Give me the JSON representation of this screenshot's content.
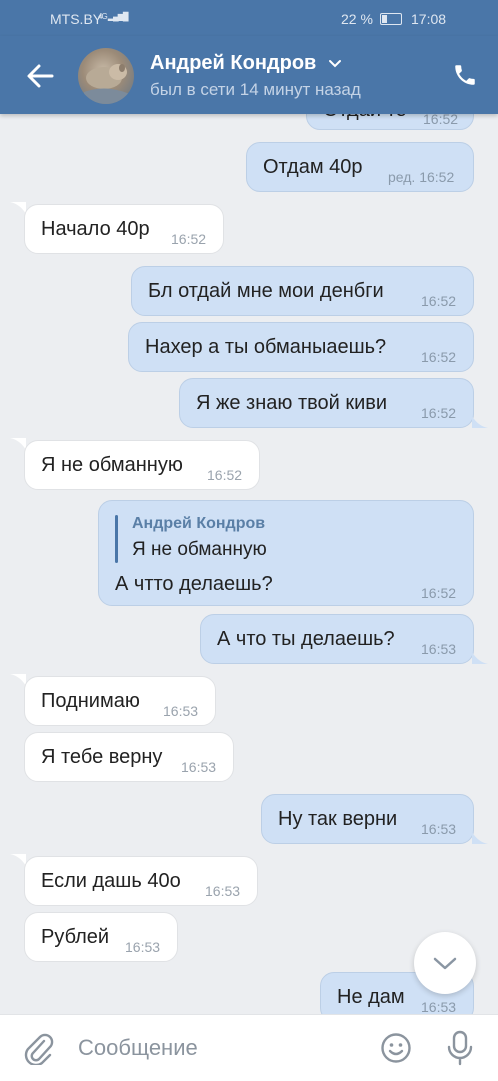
{
  "status_bar": {
    "carrier": "MTS.BY",
    "signal_label": "4G",
    "battery": "22 %",
    "time": "17:08"
  },
  "header": {
    "name": "Андрей Кондров",
    "status": "был в сети 14 минут назад"
  },
  "messages": [
    {
      "dir": "out",
      "text": "Отдай те",
      "time": "16:52"
    },
    {
      "dir": "out",
      "text": "Отдам  40р",
      "time": "ред. 16:52"
    },
    {
      "dir": "in",
      "text": "Начало 40р",
      "time": "16:52"
    },
    {
      "dir": "out",
      "text": "Бл отдай мне мои денбги",
      "time": "16:52"
    },
    {
      "dir": "out",
      "text": "Нахер а ты обманыаешь?",
      "time": "16:52"
    },
    {
      "dir": "out",
      "text": "Я же знаю твой киви",
      "time": "16:52"
    },
    {
      "dir": "in",
      "text": "Я не обманную",
      "time": "16:52"
    },
    {
      "dir": "out",
      "text": "А чтто  делаешь?",
      "time": "16:52",
      "reply": {
        "name": "Андрей Кондров",
        "text": "Я не обманную"
      }
    },
    {
      "dir": "out",
      "text": "А что ты делаешь?",
      "time": "16:53"
    },
    {
      "dir": "in",
      "text": "Поднимаю",
      "time": "16:53"
    },
    {
      "dir": "in",
      "text": "Я тебе верну",
      "time": "16:53"
    },
    {
      "dir": "out",
      "text": "Ну так верни",
      "time": "16:53"
    },
    {
      "dir": "in",
      "text": "Если дашь 40о",
      "time": "16:53"
    },
    {
      "dir": "in",
      "text": "Рублей",
      "time": "16:53"
    },
    {
      "dir": "out",
      "text": "Не дам",
      "time": "16:53"
    }
  ],
  "composer": {
    "placeholder": "Сообщение"
  },
  "colors": {
    "header_bg": "#4a76a8",
    "outgoing_bubble": "#cfe0f5",
    "incoming_bubble": "#ffffff",
    "chat_bg": "#eceef1"
  }
}
